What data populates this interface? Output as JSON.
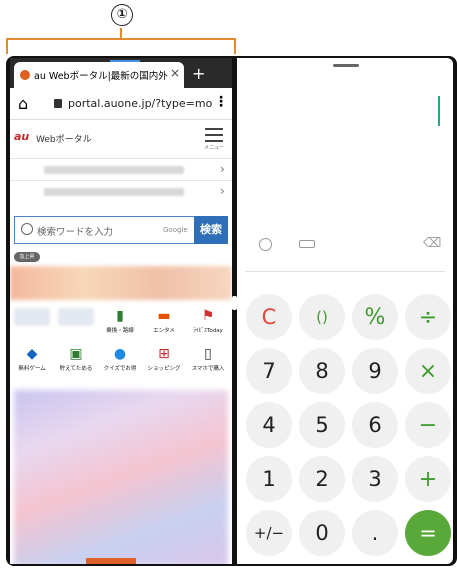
{
  "callout": {
    "number": "①"
  },
  "browser": {
    "tab_title": "au Webポータル|最新の国内外",
    "tab_close": "×",
    "new_tab": "+",
    "url": "portal.auone.jp/?type=mo",
    "home_icon": "⌂",
    "menu_icon": "⋮",
    "logo": "au",
    "logo_sub": "Webポータル",
    "menu_label": "メニュー",
    "news_chevron": "›",
    "search_placeholder": "検索ワードを入力",
    "search_provider": "Google",
    "search_button": "検索",
    "tag": "急上昇",
    "services_row1": [
      "",
      "",
      "乗換・路線",
      "エンタメ",
      "ﾗｲﾋﾞｽToday"
    ],
    "services_row2": [
      "無料ゲーム",
      "貯えてためる",
      "クイズでお得",
      "ショッピング",
      "スマホで購入"
    ]
  },
  "calculator": {
    "display": "",
    "keys": [
      [
        "C",
        "()",
        "%",
        "÷"
      ],
      [
        "7",
        "8",
        "9",
        "×"
      ],
      [
        "4",
        "5",
        "6",
        "−"
      ],
      [
        "1",
        "2",
        "3",
        "+"
      ],
      [
        "+/−",
        "0",
        ".",
        "="
      ]
    ],
    "colors": {
      "accent": "#58a83a",
      "clear": "#e0473c",
      "cursor": "#1aa98a"
    }
  }
}
